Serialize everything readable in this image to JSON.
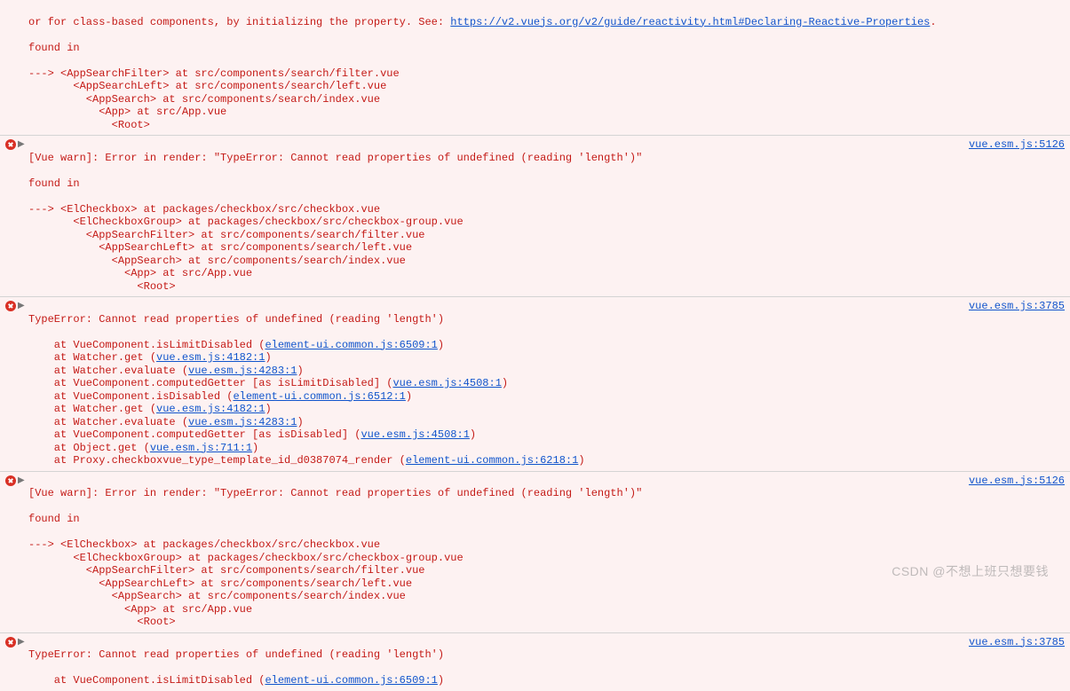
{
  "partial_top": {
    "text_before_link": "or for class-based components, by initializing the property. See: ",
    "link_text": "https://v2.vuejs.org/v2/guide/reactivity.html#Declaring-Reactive-Properties",
    "text_after_link": ".",
    "found_in": "found in",
    "trace": "---> <AppSearchFilter> at src/components/search/filter.vue\n       <AppSearchLeft> at src/components/search/left.vue\n         <AppSearch> at src/components/search/index.vue\n           <App> at src/App.vue\n             <Root>"
  },
  "row1": {
    "heading": "[Vue warn]: Error in render: \"TypeError: Cannot read properties of undefined (reading 'length')\"",
    "found_in": "found in",
    "trace": "---> <ElCheckbox> at packages/checkbox/src/checkbox.vue\n       <ElCheckboxGroup> at packages/checkbox/src/checkbox-group.vue\n         <AppSearchFilter> at src/components/search/filter.vue\n           <AppSearchLeft> at src/components/search/left.vue\n             <AppSearch> at src/components/search/index.vue\n               <App> at src/App.vue\n                 <Root>",
    "src": "vue.esm.js:5126"
  },
  "row2": {
    "heading": "TypeError: Cannot read properties of undefined (reading 'length')",
    "stack": [
      {
        "prefix": "    at VueComponent.isLimitDisabled (",
        "link": "element-ui.common.js:6509:1",
        "suffix": ")"
      },
      {
        "prefix": "    at Watcher.get (",
        "link": "vue.esm.js:4182:1",
        "suffix": ")"
      },
      {
        "prefix": "    at Watcher.evaluate (",
        "link": "vue.esm.js:4283:1",
        "suffix": ")"
      },
      {
        "prefix": "    at VueComponent.computedGetter [as isLimitDisabled] (",
        "link": "vue.esm.js:4508:1",
        "suffix": ")"
      },
      {
        "prefix": "    at VueComponent.isDisabled (",
        "link": "element-ui.common.js:6512:1",
        "suffix": ")"
      },
      {
        "prefix": "    at Watcher.get (",
        "link": "vue.esm.js:4182:1",
        "suffix": ")"
      },
      {
        "prefix": "    at Watcher.evaluate (",
        "link": "vue.esm.js:4283:1",
        "suffix": ")"
      },
      {
        "prefix": "    at VueComponent.computedGetter [as isDisabled] (",
        "link": "vue.esm.js:4508:1",
        "suffix": ")"
      },
      {
        "prefix": "    at Object.get (",
        "link": "vue.esm.js:711:1",
        "suffix": ")"
      },
      {
        "prefix": "    at Proxy.checkboxvue_type_template_id_d0387074_render (",
        "link": "element-ui.common.js:6218:1",
        "suffix": ")"
      }
    ],
    "src": "vue.esm.js:3785"
  },
  "row3": {
    "heading": "[Vue warn]: Error in render: \"TypeError: Cannot read properties of undefined (reading 'length')\"",
    "found_in": "found in",
    "trace": "---> <ElCheckbox> at packages/checkbox/src/checkbox.vue\n       <ElCheckboxGroup> at packages/checkbox/src/checkbox-group.vue\n         <AppSearchFilter> at src/components/search/filter.vue\n           <AppSearchLeft> at src/components/search/left.vue\n             <AppSearch> at src/components/search/index.vue\n               <App> at src/App.vue\n                 <Root>",
    "src": "vue.esm.js:5126"
  },
  "row4": {
    "heading": "TypeError: Cannot read properties of undefined (reading 'length')",
    "stack": [
      {
        "prefix": "    at VueComponent.isLimitDisabled (",
        "link": "element-ui.common.js:6509:1",
        "suffix": ")"
      }
    ],
    "src": "vue.esm.js:3785"
  },
  "watermark": "CSDN @不想上班只想要钱"
}
